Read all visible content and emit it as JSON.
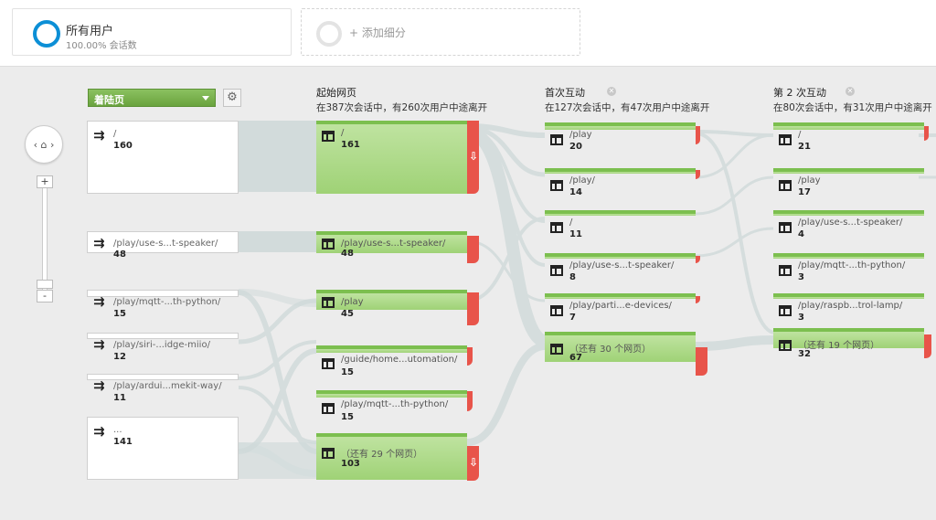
{
  "segments": {
    "primary": {
      "name": "所有用户",
      "share": "100.00% 会话数"
    },
    "add": {
      "label": "+ 添加细分"
    }
  },
  "controls": {
    "nav_label": "‹ ⌂ ›",
    "zoom_in": "+",
    "zoom_out": "-",
    "dimension_select": "着陆页",
    "settings_icon": "gear-icon"
  },
  "columns": [
    {
      "title": "起始网页",
      "summary": "在387次会话中，有260次用户中途离开"
    },
    {
      "title": "首次互动",
      "summary": "在127次会话中，有47次用户中途离开"
    },
    {
      "title": "第 2 次互动",
      "summary": "在80次会话中，有31次用户中途离开"
    }
  ],
  "landing_nodes": [
    {
      "label": "/",
      "count": "160"
    },
    {
      "label": "/play/use-s...t-speaker/",
      "count": "48"
    },
    {
      "label": "/play/mqtt-...th-python/",
      "count": "15"
    },
    {
      "label": "/play/siri-...idge-miio/",
      "count": "12"
    },
    {
      "label": "/play/ardui...mekit-way/",
      "count": "11"
    },
    {
      "label": "...",
      "count": "141"
    }
  ],
  "start_nodes": [
    {
      "label": "/",
      "count": "161"
    },
    {
      "label": "/play/use-s...t-speaker/",
      "count": "48"
    },
    {
      "label": "/play",
      "count": "45"
    },
    {
      "label": "/guide/home...utomation/",
      "count": "15"
    },
    {
      "label": "/play/mqtt-...th-python/",
      "count": "15"
    },
    {
      "label": "（还有 29 个网页）",
      "count": "103"
    }
  ],
  "first_nodes": [
    {
      "label": "/play",
      "count": "20"
    },
    {
      "label": "/play/",
      "count": "14"
    },
    {
      "label": "/",
      "count": "11"
    },
    {
      "label": "/play/use-s...t-speaker/",
      "count": "8"
    },
    {
      "label": "/play/parti...e-devices/",
      "count": "7"
    },
    {
      "label": "（还有 30 个网页）",
      "count": "67"
    }
  ],
  "second_nodes": [
    {
      "label": "/",
      "count": "21"
    },
    {
      "label": "/play",
      "count": "17"
    },
    {
      "label": "/play/use-s...t-speaker/",
      "count": "4"
    },
    {
      "label": "/play/mqtt-...th-python/",
      "count": "3"
    },
    {
      "label": "/play/raspb...trol-lamp/",
      "count": "3"
    },
    {
      "label": "（还有 19 个网页）",
      "count": "32"
    }
  ],
  "colors": {
    "accent": "#0c8fd6",
    "node_green": "#9fd276",
    "dropoff_red": "#e8544a",
    "flow_grey": "#d3dcdc"
  }
}
